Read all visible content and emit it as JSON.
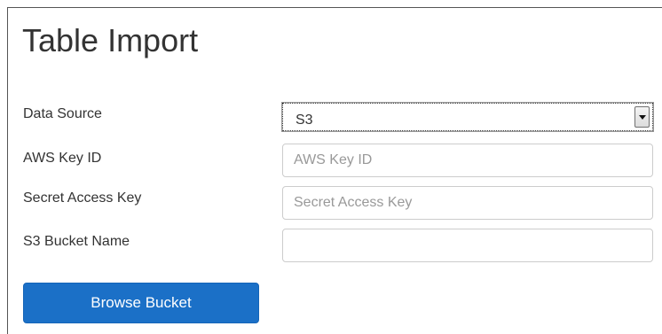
{
  "page": {
    "title": "Table Import"
  },
  "form": {
    "data_source": {
      "label": "Data Source",
      "selected": "S3"
    },
    "aws_key_id": {
      "label": "AWS Key ID",
      "value": "",
      "placeholder": "AWS Key ID"
    },
    "secret_access_key": {
      "label": "Secret Access Key",
      "value": "",
      "placeholder": "Secret Access Key"
    },
    "s3_bucket_name": {
      "label": "S3 Bucket Name",
      "value": "",
      "placeholder": ""
    },
    "browse_button_label": "Browse Bucket"
  },
  "colors": {
    "button_bg": "#1b70c7",
    "button_text": "#ffffff",
    "title_text": "#333333",
    "placeholder_text": "#999999"
  }
}
